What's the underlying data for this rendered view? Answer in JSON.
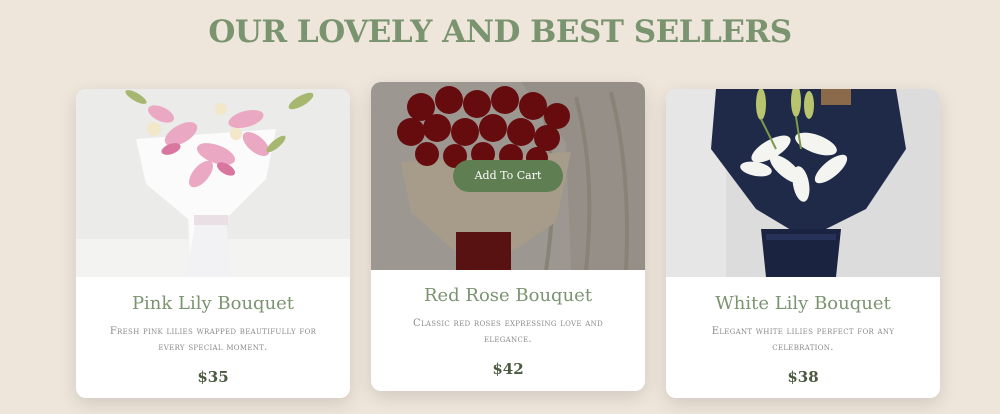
{
  "section": {
    "title": "OUR LOVELY AND BEST SELLERS"
  },
  "products": [
    {
      "name": "Pink Lily Bouquet",
      "description": "Fresh pink lilies wrapped beautifully for every special moment.",
      "price": "$35"
    },
    {
      "name": "Red Rose Bouquet",
      "description": "Classic red roses expressing love and elegance.",
      "price": "$42",
      "cta_label": "Add To Cart"
    },
    {
      "name": "White Lily Bouquet",
      "description": "Elegant white lilies perfect for any celebration.",
      "price": "$38"
    }
  ],
  "colors": {
    "background": "#efe6db",
    "accent_green": "#7b9470",
    "button_green": "#5f7e52",
    "price_text": "#4a5a40"
  }
}
